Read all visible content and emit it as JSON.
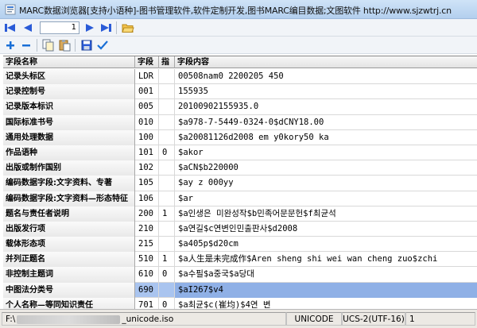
{
  "window": {
    "title": "MARC数据浏览器[支持小语种]-图书管理软件,软件定制开发,图书MARC编目数据;文图软件 http://www.sjzwtrj.cn"
  },
  "toolbar": {
    "record_number": "1",
    "icons": [
      "first-icon",
      "prev-icon",
      "next-icon",
      "last-icon",
      "open-folder-icon",
      "add-icon",
      "remove-icon",
      "copy-icon",
      "paste-icon",
      "save-icon",
      "check-icon"
    ],
    "colors": {
      "nav": "#2a5bd7",
      "add": "#1a6fd6",
      "check": "#1a6fd6"
    }
  },
  "table": {
    "headers": {
      "name": "字段名称",
      "tag": "字段",
      "ind": "指",
      "content": "字段内容"
    },
    "rows": [
      {
        "name": "记录头标区",
        "tag": "LDR",
        "ind": "",
        "content": "00508nam0 2200205   450"
      },
      {
        "name": "记录控制号",
        "tag": "001",
        "ind": "",
        "content": "155935"
      },
      {
        "name": "记录版本标识",
        "tag": "005",
        "ind": "",
        "content": "20100902155935.0"
      },
      {
        "name": "国际标准书号",
        "tag": "010",
        "ind": "",
        "content": "$a978-7-5449-0324-0$dCNY18.00"
      },
      {
        "name": "通用处理数据",
        "tag": "100",
        "ind": "",
        "content": "$a20081126d2008    em y0kory50      ka"
      },
      {
        "name": "作品语种",
        "tag": "101",
        "ind": "0",
        "content": "$akor"
      },
      {
        "name": "出版或制作国别",
        "tag": "102",
        "ind": "",
        "content": "$aCN$b220000"
      },
      {
        "name": "编码数据字段:文字资料、专著",
        "tag": "105",
        "ind": "",
        "content": "$ay   z   000yy"
      },
      {
        "name": "编码数据字段:文字资料—形态特征",
        "tag": "106",
        "ind": "",
        "content": "$ar"
      },
      {
        "name": "题名与责任者说明",
        "tag": "200",
        "ind": "1",
        "content": "$a인생은 미완성작$b민족어문문헌$f최균석"
      },
      {
        "name": "出版发行项",
        "tag": "210",
        "ind": "",
        "content": "$a연길$c연변인민출판사$d2008"
      },
      {
        "name": "载体形态项",
        "tag": "215",
        "ind": "",
        "content": "$a405p$d20cm"
      },
      {
        "name": "并列正题名",
        "tag": "510",
        "ind": "1",
        "content": "$a人生是未完成作$Aren sheng shi wei wan cheng zuo$zchi"
      },
      {
        "name": "非控制主题词",
        "tag": "610",
        "ind": "0",
        "content": "$a수필$a중국$a당대"
      },
      {
        "name": "中图法分类号",
        "tag": "690",
        "ind": "",
        "content": "$aI267$v4",
        "selected": true
      },
      {
        "name": "个人名称—等同知识责任",
        "tag": "701",
        "ind": "0",
        "content": "$a최균$c(崔均)$4연 변"
      }
    ]
  },
  "status": {
    "file_prefix": "F:\\",
    "file_suffix": "_unicode.iso",
    "encoding": "UNICODE",
    "charset": "UCS-2(UTF-16)",
    "record_no": "1"
  }
}
